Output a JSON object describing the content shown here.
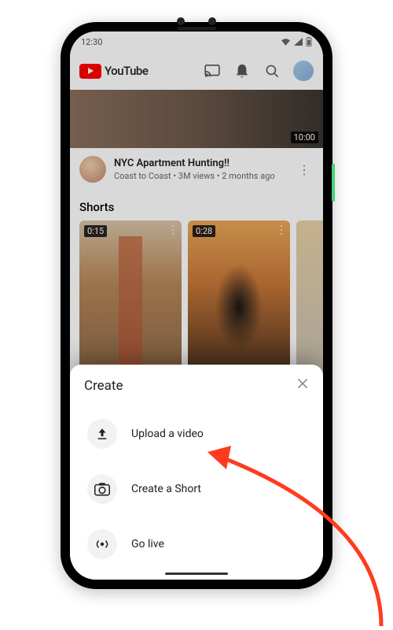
{
  "statusbar": {
    "time": "12:30"
  },
  "header": {
    "brand": "YouTube"
  },
  "hero": {
    "duration": "10:00"
  },
  "video": {
    "title": "NYC Apartment Hunting!!",
    "subtitle": "Coast to Coast • 3M views • 2 months ago"
  },
  "shorts": {
    "heading": "Shorts",
    "items": [
      {
        "duration": "0:15"
      },
      {
        "duration": "0:28"
      }
    ]
  },
  "sheet": {
    "title": "Create",
    "items": [
      {
        "label": "Upload a video"
      },
      {
        "label": "Create a Short"
      },
      {
        "label": "Go live"
      }
    ]
  }
}
